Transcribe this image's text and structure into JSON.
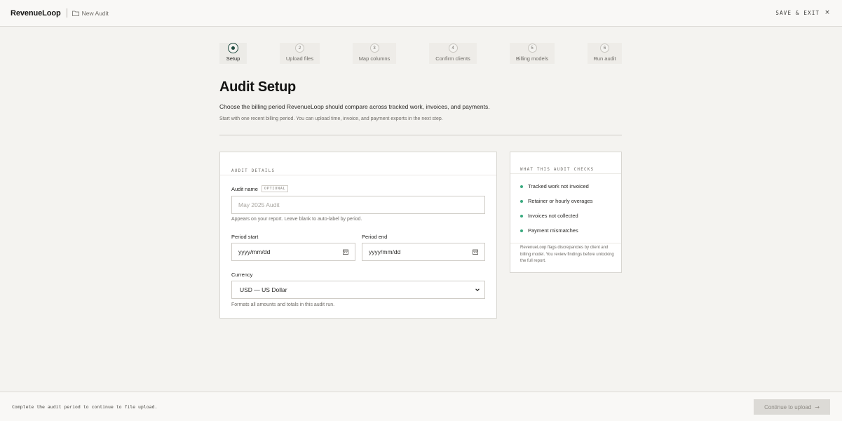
{
  "header": {
    "brand": "RevenueLoop",
    "breadcrumb": "New Audit",
    "breadcrumb_icon": "folder-icon",
    "save_exit": "SAVE & EXIT",
    "close_glyph": "×"
  },
  "steps": [
    {
      "number": "",
      "label": "Setup",
      "state": "active"
    },
    {
      "number": "2",
      "label": "Upload files",
      "state": "upcoming"
    },
    {
      "number": "3",
      "label": "Map columns",
      "state": "upcoming"
    },
    {
      "number": "4",
      "label": "Confirm clients",
      "state": "upcoming"
    },
    {
      "number": "5",
      "label": "Billing models",
      "state": "upcoming"
    },
    {
      "number": "6",
      "label": "Run audit",
      "state": "upcoming"
    }
  ],
  "page": {
    "title": "Audit Setup",
    "subtitle": "Choose the billing period RevenueLoop should compare across tracked work, invoices, and payments.",
    "hint": "Start with one recent billing period. You can upload time, invoice, and payment exports in the next step."
  },
  "form": {
    "section_label": "AUDIT DETAILS",
    "audit_name": {
      "label": "Audit name",
      "badge": "OPTIONAL",
      "placeholder": "May 2025 Audit",
      "value": "",
      "help": "Appears on your report. Leave blank to auto-label by period."
    },
    "period_start": {
      "label": "Period start",
      "value": "yyyy/mm/dd"
    },
    "period_end": {
      "label": "Period end",
      "value": "yyyy/mm/dd"
    },
    "currency": {
      "label": "Currency",
      "selected": "USD — US Dollar",
      "help": "Formats all amounts and totals in this audit run."
    }
  },
  "checks": {
    "section_label": "WHAT THIS AUDIT CHECKS",
    "items": [
      "Tracked work not invoiced",
      "Retainer or hourly overages",
      "Invoices not collected",
      "Payment mismatches"
    ],
    "note": "RevenueLoop flags discrepancies by client and billing model. You review findings before unlocking the full report.",
    "bullet_color": "#3aaa7f"
  },
  "footer": {
    "message": "Complete the audit period to continue to file upload.",
    "continue_label": "Continue to upload",
    "continue_arrow": "→",
    "continue_enabled": false
  },
  "colors": {
    "accent": "#1f4a3f",
    "background": "#f4f3f0"
  }
}
